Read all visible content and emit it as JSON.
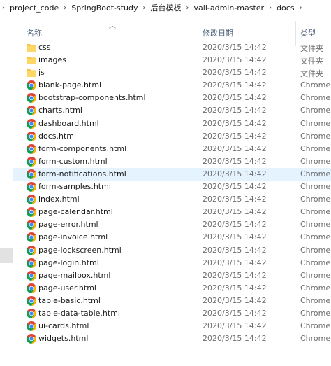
{
  "breadcrumb": [
    "project_code",
    "SpringBoot-study",
    "后台模板",
    "vali-admin-master",
    "docs"
  ],
  "header": {
    "name": "名称",
    "date": "修改日期",
    "type": "类型"
  },
  "files": [
    {
      "name": "css",
      "date": "2020/3/15 14:42",
      "type": "文件夹",
      "icon": "folder-icon"
    },
    {
      "name": "images",
      "date": "2020/3/15 14:42",
      "type": "文件夹",
      "icon": "folder-icon"
    },
    {
      "name": "js",
      "date": "2020/3/15 14:42",
      "type": "文件夹",
      "icon": "folder-icon"
    },
    {
      "name": "blank-page.html",
      "date": "2020/3/15 14:42",
      "type": "Chrome",
      "icon": "chrome-icon"
    },
    {
      "name": "bootstrap-components.html",
      "date": "2020/3/15 14:42",
      "type": "Chrome",
      "icon": "chrome-icon"
    },
    {
      "name": "charts.html",
      "date": "2020/3/15 14:42",
      "type": "Chrome",
      "icon": "chrome-icon"
    },
    {
      "name": "dashboard.html",
      "date": "2020/3/15 14:42",
      "type": "Chrome",
      "icon": "chrome-icon"
    },
    {
      "name": "docs.html",
      "date": "2020/3/15 14:42",
      "type": "Chrome",
      "icon": "chrome-icon"
    },
    {
      "name": "form-components.html",
      "date": "2020/3/15 14:42",
      "type": "Chrome",
      "icon": "chrome-icon"
    },
    {
      "name": "form-custom.html",
      "date": "2020/3/15 14:42",
      "type": "Chrome",
      "icon": "chrome-icon"
    },
    {
      "name": "form-notifications.html",
      "date": "2020/3/15 14:42",
      "type": "Chrome",
      "icon": "chrome-icon",
      "selected": true
    },
    {
      "name": "form-samples.html",
      "date": "2020/3/15 14:42",
      "type": "Chrome",
      "icon": "chrome-icon"
    },
    {
      "name": "index.html",
      "date": "2020/3/15 14:42",
      "type": "Chrome",
      "icon": "chrome-icon"
    },
    {
      "name": "page-calendar.html",
      "date": "2020/3/15 14:42",
      "type": "Chrome",
      "icon": "chrome-icon"
    },
    {
      "name": "page-error.html",
      "date": "2020/3/15 14:42",
      "type": "Chrome",
      "icon": "chrome-icon"
    },
    {
      "name": "page-invoice.html",
      "date": "2020/3/15 14:42",
      "type": "Chrome",
      "icon": "chrome-icon"
    },
    {
      "name": "page-lockscreen.html",
      "date": "2020/3/15 14:42",
      "type": "Chrome",
      "icon": "chrome-icon"
    },
    {
      "name": "page-login.html",
      "date": "2020/3/15 14:42",
      "type": "Chrome",
      "icon": "chrome-icon"
    },
    {
      "name": "page-mailbox.html",
      "date": "2020/3/15 14:42",
      "type": "Chrome",
      "icon": "chrome-icon"
    },
    {
      "name": "page-user.html",
      "date": "2020/3/15 14:42",
      "type": "Chrome",
      "icon": "chrome-icon"
    },
    {
      "name": "table-basic.html",
      "date": "2020/3/15 14:42",
      "type": "Chrome",
      "icon": "chrome-icon"
    },
    {
      "name": "table-data-table.html",
      "date": "2020/3/15 14:42",
      "type": "Chrome",
      "icon": "chrome-icon"
    },
    {
      "name": "ui-cards.html",
      "date": "2020/3/15 14:42",
      "type": "Chrome",
      "icon": "chrome-icon"
    },
    {
      "name": "widgets.html",
      "date": "2020/3/15 14:42",
      "type": "Chrome",
      "icon": "chrome-icon"
    }
  ],
  "colors": {
    "selected_row": "#e5f3ff",
    "header_text": "#4c607a",
    "folder": "#f5c242",
    "chrome_red": "#db4437",
    "chrome_yellow": "#f4b400",
    "chrome_green": "#0f9d58",
    "chrome_blue": "#4285f4"
  }
}
